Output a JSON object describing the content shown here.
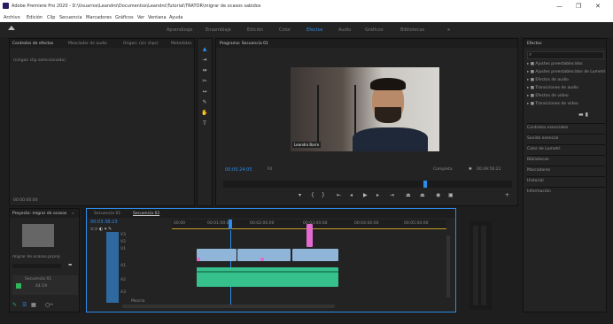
{
  "app": {
    "title": "Adobe Premiere Pro 2020 - D:\\Usuarios\\Leandro\\Documentos\\Leandro\\Tutorial\\TRATOR\\migrar de ocasos sabidos",
    "menu": [
      "Archivo",
      "Edición",
      "Clip",
      "Secuencia",
      "Marcadores",
      "Gráficos",
      "Ver",
      "Ventana",
      "Ayuda"
    ],
    "workspaces": [
      "Aprendizaje",
      "Ensamblaje",
      "Edición",
      "Color",
      "Efectos",
      "Audio",
      "Gráficos",
      "Bibliotecas"
    ],
    "active_workspace": "Efectos",
    "window_controls": [
      "—",
      "❐",
      "✕"
    ]
  },
  "source_panel": {
    "tabs": [
      "Controles de efectos",
      "Mezclador de audio",
      "Origen: (sin clips)",
      "Metadatos"
    ],
    "placeholder": "(ningún clip seleccionado)",
    "timecode": "00:00:00:00"
  },
  "program_monitor": {
    "tab": "Programa: Secuencia 01",
    "clip_label": "Leandro Barro",
    "timecode_current": "00:00:24:05",
    "fit": "Fit",
    "quality": "Completa",
    "timecode_total": "00:49:56:21"
  },
  "project_panel": {
    "tab": "Proyecto: migrar de ocasos",
    "file_name": "migrar de ocasos.prproj",
    "item_label": "Secuencia 01",
    "item_duration": "44:19"
  },
  "timeline": {
    "tabs": [
      "Secuencia 01",
      "Secuencia 02"
    ],
    "active_tab": "Secuencia 02",
    "timecode": "00:03:38:23",
    "ruler_labels": [
      "00:00",
      "00:01:00:00",
      "00:02:00:00",
      "00:03:00:00",
      "00:04:00:00",
      "00:05:00:00"
    ],
    "tracks_video": [
      "V3",
      "V2",
      "V1"
    ],
    "tracks_audio": [
      "A1",
      "A2",
      "A3"
    ],
    "master_label": "Mezcla"
  },
  "effects_panel": {
    "tab": "Efectos",
    "search_placeholder": "",
    "folders": [
      "Ajustes preestablecidos",
      "Ajustes preestablecidos de Lumetri",
      "Efectos de audio",
      "Transiciones de audio",
      "Efectos de vídeo",
      "Transiciones de vídeo"
    ],
    "sections": [
      "Controles esenciales",
      "Sonido esencial",
      "Color de Lumetri",
      "Bibliotecas",
      "Marcadores",
      "Historial",
      "Información"
    ]
  },
  "colors": {
    "accent": "#2d8ceb",
    "video_clip": "#8fb5d8",
    "audio_clip": "#35c08c",
    "pink_marker": "#e46ad0"
  }
}
